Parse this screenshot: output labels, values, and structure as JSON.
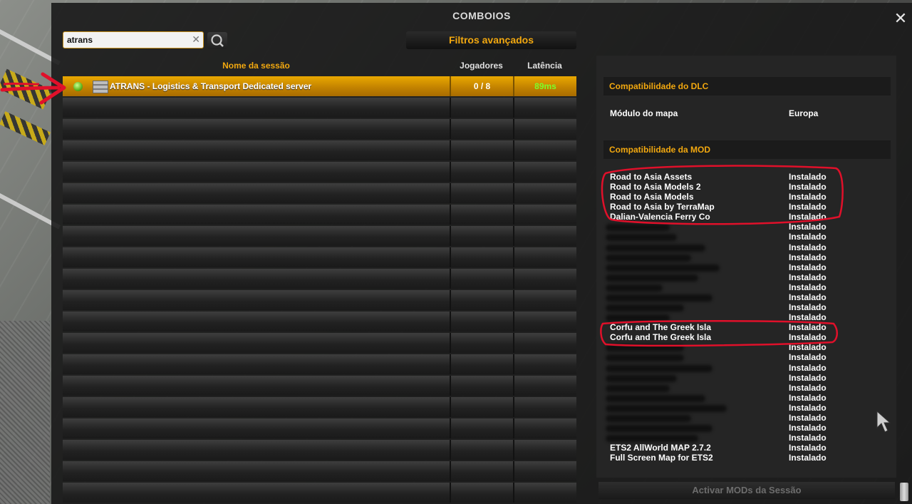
{
  "window": {
    "title": "COMBOIOS",
    "close_label": "✕"
  },
  "search": {
    "value": "atrans",
    "clear_label": "✕"
  },
  "advanced_filters_label": "Filtros avançados",
  "table": {
    "headers": {
      "session": "Nome da sessão",
      "players": "Jogadores",
      "latency": "Latência"
    },
    "rows": [
      {
        "name": "ATRANS - Logistics & Transport Dedicated server",
        "players": "0 / 8",
        "latency": "89ms",
        "online": true
      }
    ],
    "empty_rows": 19
  },
  "panel": {
    "dlc_header": "Compatibilidade do DLC",
    "map_module_label": "Módulo do mapa",
    "map_module_value": "Europa",
    "mod_header": "Compatibilidade da MOD",
    "installed_label": "Instalado",
    "mods": [
      "Road to Asia Assets",
      "Road to Asia Models 2",
      "Road to Asia Models",
      "Road to Asia by TerraMap",
      "Dalian-Valencia Ferry Co",
      "",
      "",
      "",
      "",
      "",
      "",
      "",
      "",
      "",
      "",
      "Corfu and The Greek Isla",
      "Corfu and The Greek Isla",
      "",
      "",
      "",
      "",
      "",
      "",
      "",
      "",
      "",
      "",
      "ETS2 AllWorld MAP 2.7.2",
      "Full Screen Map for ETS2"
    ]
  },
  "activate_label": "Activar MODs da Sessão",
  "colors": {
    "accent": "#f2a80f",
    "selected_row": "#d99600",
    "latency_good": "#7cff2a",
    "annotation": "#e0102a"
  }
}
